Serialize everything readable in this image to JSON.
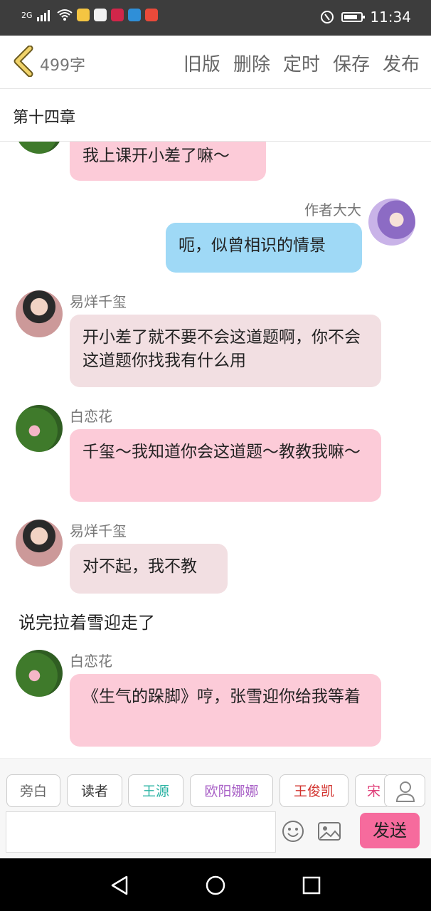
{
  "status_bar": {
    "network": "2G",
    "time": "11:34"
  },
  "toolbar": {
    "word_count": "499字",
    "actions": [
      "旧版",
      "删除",
      "定时",
      "保存",
      "发布"
    ]
  },
  "chapter": {
    "title": "第十四章"
  },
  "messages": [
    {
      "type": "left",
      "speaker": "",
      "text": "我上课开小差了嘛～",
      "style": "pink"
    },
    {
      "type": "right",
      "speaker": "作者大大",
      "text": "呃，似曾相识的情景",
      "style": "blue"
    },
    {
      "type": "left",
      "speaker": "易烊千玺",
      "text": "开小差了就不要不会这道题啊，你不会这道题你找我有什么用",
      "style": "gray"
    },
    {
      "type": "left",
      "speaker": "白恋花",
      "text": "千玺～我知道你会这道题～教教我嘛～",
      "style": "pink"
    },
    {
      "type": "left",
      "speaker": "易烊千玺",
      "text": "对不起，我不教",
      "style": "gray"
    },
    {
      "type": "narration",
      "text": "说完拉着雪迎走了"
    },
    {
      "type": "left",
      "speaker": "白恋花",
      "text": "《生气的跺脚》哼，张雪迎你给我等着",
      "style": "pink"
    }
  ],
  "characters": [
    {
      "label": "旁白",
      "color": "#666666"
    },
    {
      "label": "读者",
      "color": "#333333"
    },
    {
      "label": "王源",
      "color": "#2bb3a3"
    },
    {
      "label": "欧阳娜娜",
      "color": "#a860c6"
    },
    {
      "label": "王俊凯",
      "color": "#d2332e"
    },
    {
      "label": "宋",
      "color": "#e0407a"
    }
  ],
  "input": {
    "value": "",
    "send_label": "发送"
  },
  "colors": {
    "accent": "#f66b9d",
    "bubble_pink": "#fccbd8",
    "bubble_gray": "#f2dfe2",
    "bubble_blue": "#9fd9f6"
  },
  "icons": [
    "back-chevron-icon",
    "emoji-icon",
    "image-icon",
    "user-icon",
    "nav-back-icon",
    "nav-home-icon",
    "nav-recent-icon"
  ]
}
